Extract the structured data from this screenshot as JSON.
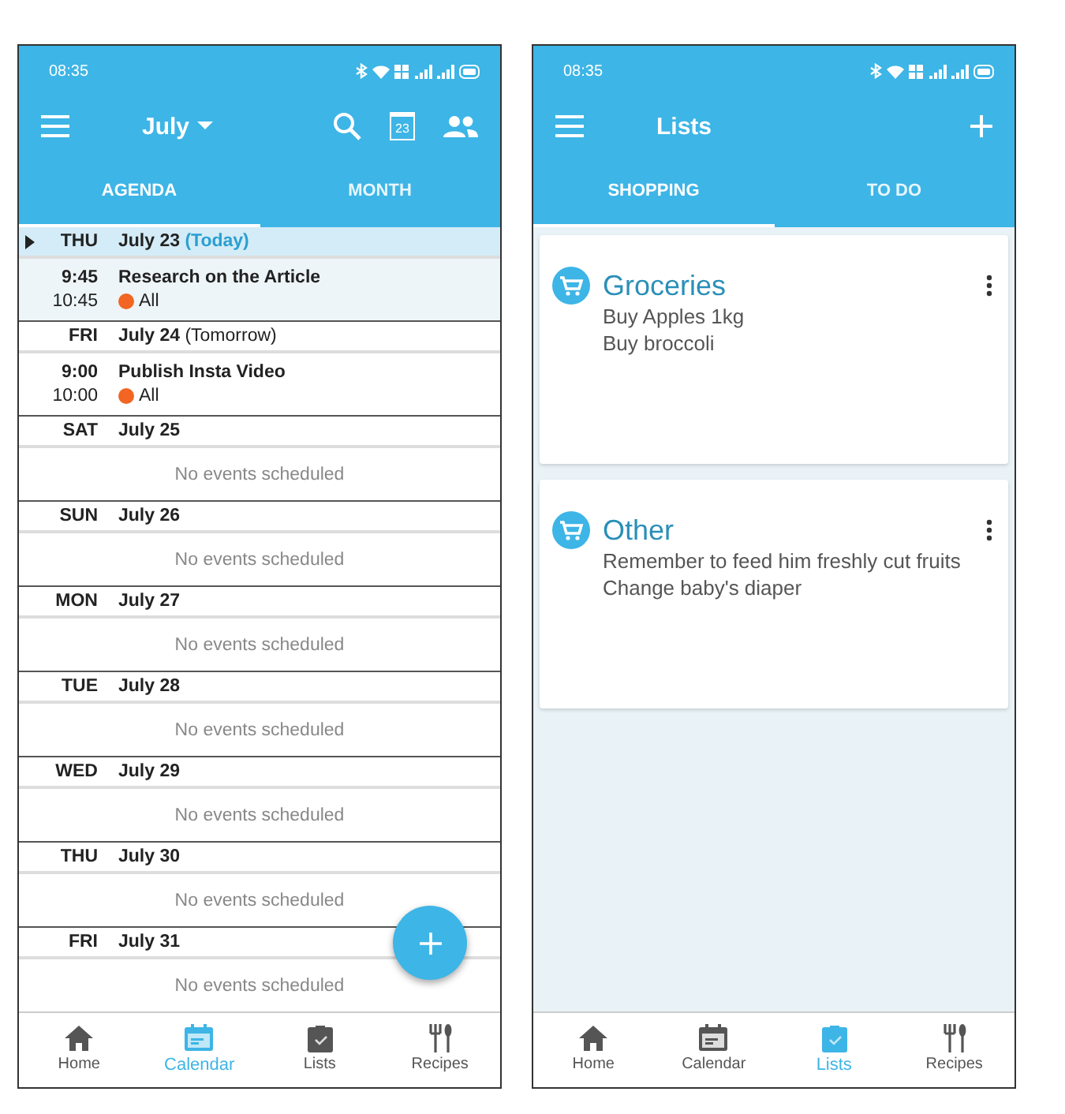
{
  "calendar_screen": {
    "status_time": "08:35",
    "app_bar": {
      "title": "July",
      "calendar_day": "23"
    },
    "tabs": [
      {
        "label": "AGENDA",
        "selected": true
      },
      {
        "label": "MONTH",
        "selected": false
      }
    ],
    "agenda": [
      {
        "weekday": "THU",
        "date": "July 23",
        "note": "(Today)",
        "selected": true,
        "events": [
          {
            "start": "9:45",
            "end": "10:45",
            "title": "Research on the Article",
            "calendar": "All",
            "color": "#f26522"
          }
        ]
      },
      {
        "weekday": "FRI",
        "date": "July 24",
        "note": "(Tomorrow)",
        "selected": false,
        "events": [
          {
            "start": "9:00",
            "end": "10:00",
            "title": "Publish Insta Video",
            "calendar": "All",
            "color": "#f26522"
          }
        ]
      },
      {
        "weekday": "SAT",
        "date": "July 25",
        "selected": false,
        "empty_text": "No events scheduled"
      },
      {
        "weekday": "SUN",
        "date": "July 26",
        "selected": false,
        "empty_text": "No events scheduled"
      },
      {
        "weekday": "MON",
        "date": "July 27",
        "selected": false,
        "empty_text": "No events scheduled"
      },
      {
        "weekday": "TUE",
        "date": "July 28",
        "selected": false,
        "empty_text": "No events scheduled"
      },
      {
        "weekday": "WED",
        "date": "July 29",
        "selected": false,
        "empty_text": "No events scheduled"
      },
      {
        "weekday": "THU",
        "date": "July 30",
        "selected": false,
        "empty_text": "No events scheduled"
      },
      {
        "weekday": "FRI",
        "date": "July 31",
        "selected": false,
        "empty_text": "No events scheduled"
      }
    ],
    "bottom_nav": [
      {
        "label": "Home",
        "kind": "home",
        "selected": false
      },
      {
        "label": "Calendar",
        "kind": "calendar",
        "selected": true
      },
      {
        "label": "Lists",
        "kind": "lists",
        "selected": false
      },
      {
        "label": "Recipes",
        "kind": "recipes",
        "selected": false
      }
    ]
  },
  "lists_screen": {
    "status_time": "08:35",
    "app_bar": {
      "title": "Lists"
    },
    "tabs": [
      {
        "label": "SHOPPING",
        "selected": true
      },
      {
        "label": "TO DO",
        "selected": false
      }
    ],
    "lists": [
      {
        "title": "Groceries",
        "items": [
          "Buy Apples 1kg",
          "Buy broccoli"
        ]
      },
      {
        "title": "Other",
        "items": [
          "Remember to feed him freshly cut fruits",
          "Change baby's diaper"
        ]
      }
    ],
    "bottom_nav": [
      {
        "label": "Home",
        "kind": "home",
        "selected": false
      },
      {
        "label": "Calendar",
        "kind": "calendar",
        "selected": false
      },
      {
        "label": "Lists",
        "kind": "lists",
        "selected": true
      },
      {
        "label": "Recipes",
        "kind": "recipes",
        "selected": false
      }
    ]
  }
}
